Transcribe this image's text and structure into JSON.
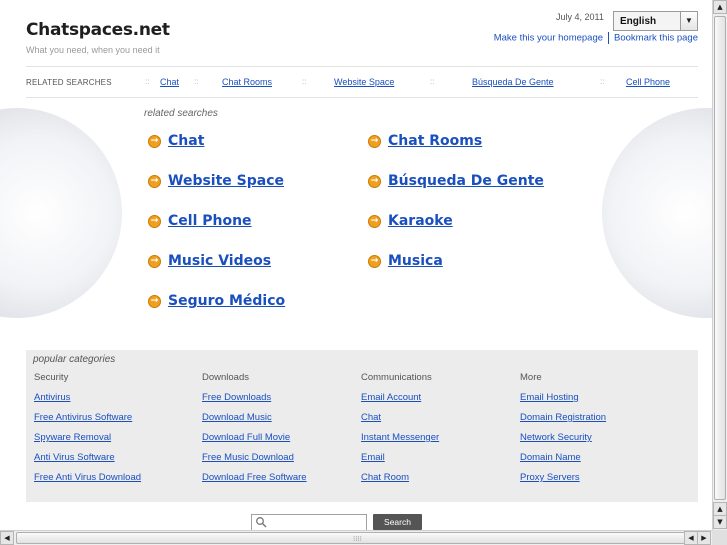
{
  "header": {
    "logo": "Chatspaces.net",
    "tagline": "What you need, when you need it",
    "date": "July 4, 2011",
    "language": "English",
    "make_homepage": "Make this your homepage",
    "bookmark": "Bookmark this page"
  },
  "related_bar": {
    "label": "RELATED SEARCHES",
    "separator": "::",
    "items": [
      "Chat",
      "Chat Rooms",
      "Website Space",
      "Búsqueda De Gente",
      "Cell Phone"
    ]
  },
  "related_searches": {
    "title": "related searches",
    "links": [
      "Chat",
      "Chat Rooms",
      "Website Space",
      "Búsqueda De Gente",
      "Cell Phone",
      "Karaoke",
      "Music Videos",
      "Musica",
      "Seguro Médico"
    ]
  },
  "popular": {
    "title": "popular categories",
    "columns": [
      {
        "heading": "Security",
        "links": [
          "Antivirus",
          "Free Antivirus Software",
          "Spyware Removal",
          "Anti Virus Software",
          "Free Anti Virus Download"
        ]
      },
      {
        "heading": "Downloads",
        "links": [
          "Free Downloads",
          "Download Music",
          "Download Full Movie",
          "Free Music Download",
          "Download Free Software"
        ]
      },
      {
        "heading": "Communications",
        "links": [
          "Email Account",
          "Chat",
          "Instant Messenger",
          "Email",
          "Chat Room"
        ]
      },
      {
        "heading": "More",
        "links": [
          "Email Hosting",
          "Domain Registration",
          "Network Security",
          "Domain Name",
          "Proxy Servers"
        ]
      }
    ]
  },
  "search": {
    "button": "Search",
    "value": ""
  },
  "colors": {
    "link": "#1a4fbf",
    "arrow_icon": "#f0a020",
    "popular_bg": "#ececec"
  }
}
